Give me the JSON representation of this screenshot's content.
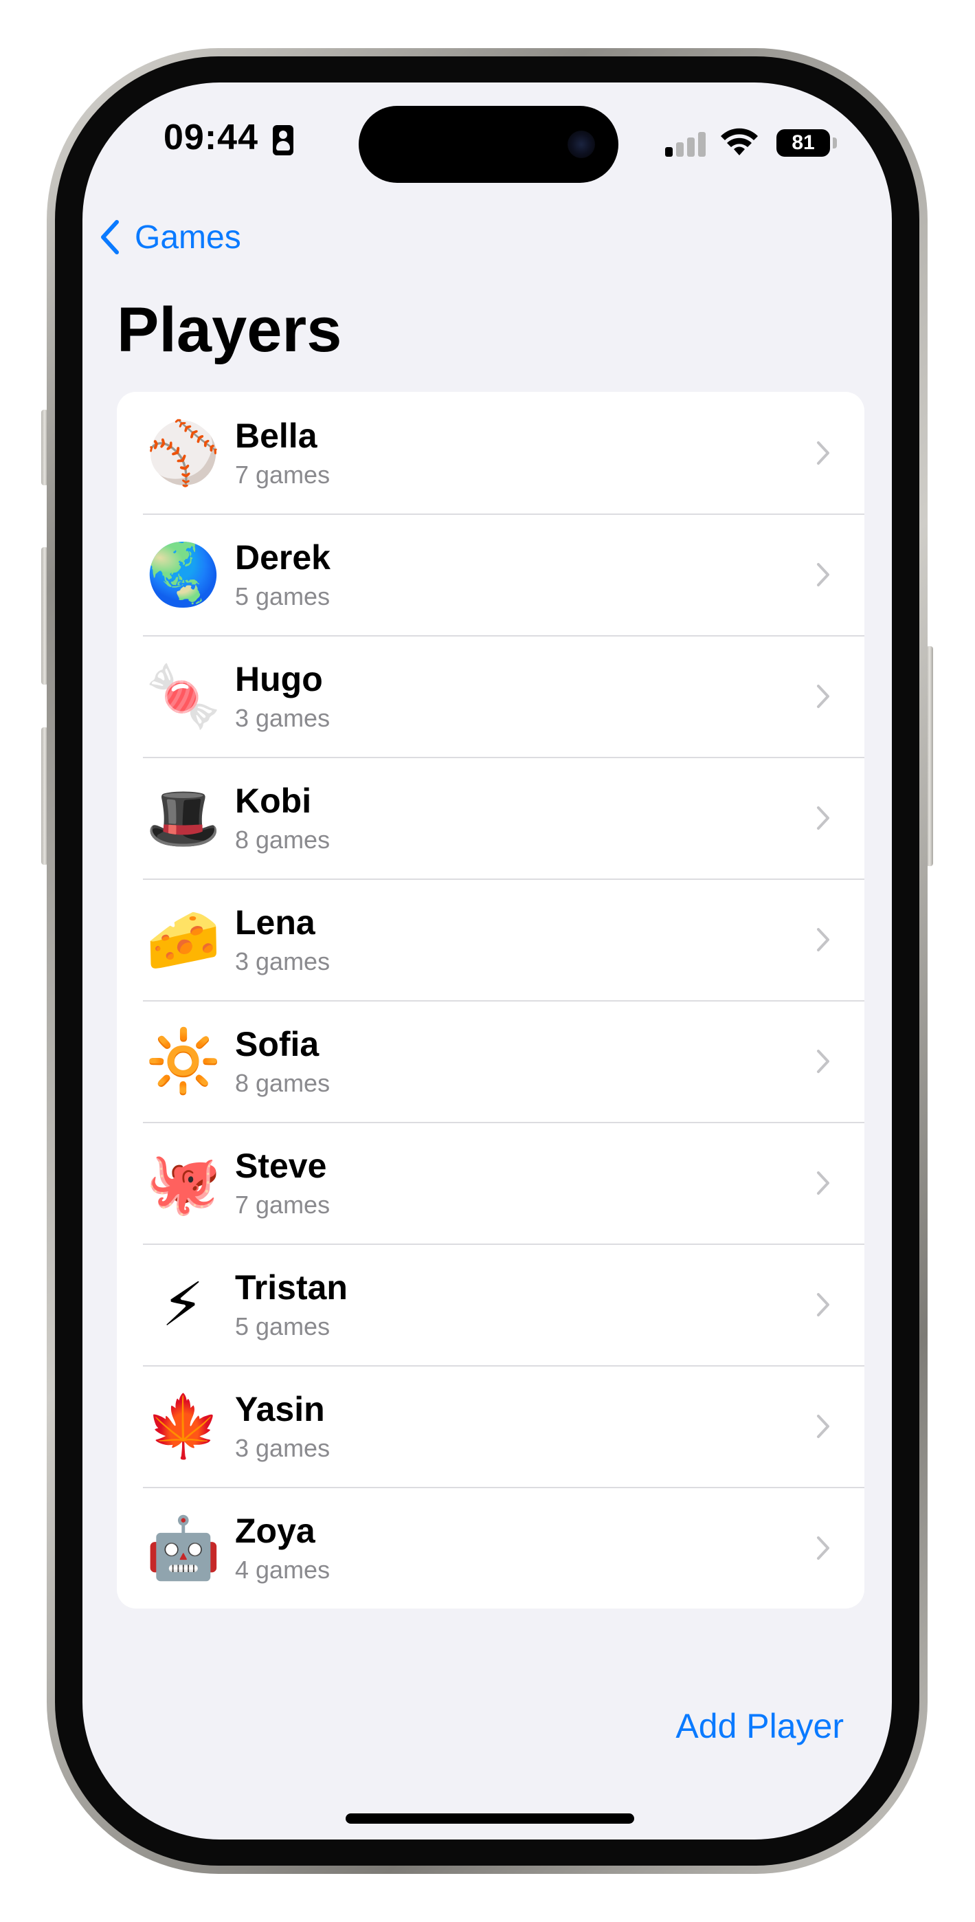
{
  "status_bar": {
    "time": "09:44",
    "battery": "81"
  },
  "nav": {
    "back_label": "Games"
  },
  "page": {
    "title": "Players"
  },
  "players": [
    {
      "emoji": "⚾",
      "name": "Bella",
      "games": "7 games"
    },
    {
      "emoji": "🌏",
      "name": "Derek",
      "games": "5 games"
    },
    {
      "emoji": "🍬",
      "name": "Hugo",
      "games": "3 games"
    },
    {
      "emoji": "🎩",
      "name": "Kobi",
      "games": "8 games"
    },
    {
      "emoji": "🧀",
      "name": "Lena",
      "games": "3 games"
    },
    {
      "emoji": "🔆",
      "name": "Sofia",
      "games": "8 games"
    },
    {
      "emoji": "🐙",
      "name": "Steve",
      "games": "7 games"
    },
    {
      "emoji": "⚡",
      "name": "Tristan",
      "games": "5 games"
    },
    {
      "emoji": "🍁",
      "name": "Yasin",
      "games": "3 games"
    },
    {
      "emoji": "🤖",
      "name": "Zoya",
      "games": "4 games"
    }
  ],
  "footer": {
    "add_player_label": "Add Player"
  },
  "colors": {
    "accent": "#0a7aff",
    "background": "#f2f2f7",
    "secondary_text": "#8a8a8e"
  }
}
